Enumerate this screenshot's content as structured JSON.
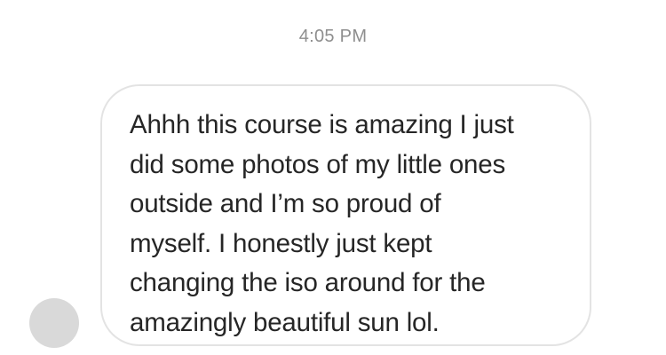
{
  "chat": {
    "timestamp": "4:05 PM",
    "message": {
      "lines": [
        "Ahhh this course is amazing I just",
        "did some photos of my little ones",
        "outside and I’m so proud of",
        "myself. I honestly just kept",
        "changing the iso around for the",
        "amazingly beautiful sun lol."
      ]
    }
  },
  "colors": {
    "timestamp": "#8e8e8e",
    "bubble_border": "#e3e3e3",
    "text": "#262626",
    "avatar": "#d9d9d9"
  }
}
